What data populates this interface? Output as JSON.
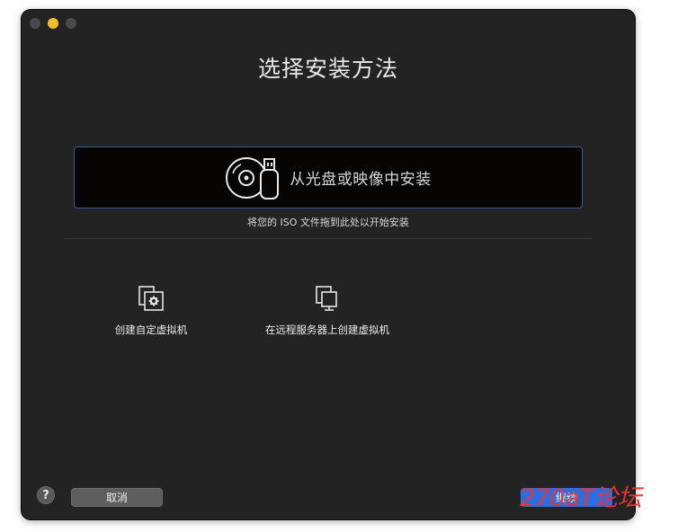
{
  "window": {
    "title": "选择安装方法"
  },
  "iso": {
    "label": "从光盘或映像中安装",
    "icon": "disc-usb-icon",
    "hint": "将您的 ISO 文件拖到此处以开始安装"
  },
  "options": {
    "custom": {
      "label": "创建自定虚拟机",
      "icon": "custom-vm-icon"
    },
    "remote": {
      "label": "在远程服务器上创建虚拟机",
      "icon": "remote-server-icon"
    }
  },
  "footer": {
    "help": "?",
    "cancel": "取消",
    "continue": "继续"
  },
  "watermark": "270aT论坛",
  "colors": {
    "window_bg": "#232323",
    "accent": "#2f6ce0",
    "selection_border": "#3f5a8f",
    "watermark": "#e63631"
  }
}
